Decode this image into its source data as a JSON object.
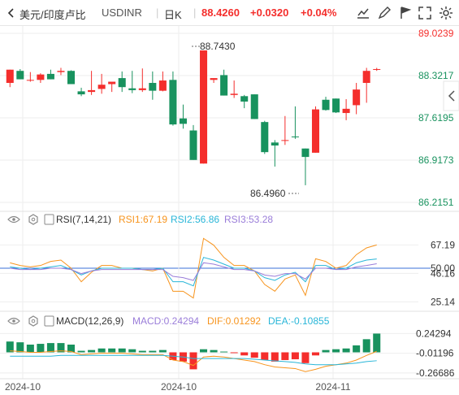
{
  "header": {
    "symbol_label": "美元/印度卢比",
    "symbol_code": "USDINR",
    "period": "日K",
    "price": "88.4260",
    "change": "+0.0320",
    "change_pct": "+0.04%",
    "buttons": [
      "chart-style-icon",
      "draw-icon",
      "flag-icon",
      "fullscreen-icon",
      "settings-icon"
    ]
  },
  "colors": {
    "up": "#f42e2c",
    "down": "#18925e",
    "ma_orange": "#f7941d",
    "ma_blue": "#29b6d8",
    "ma_purple": "#9a7dd9",
    "grid": "#eeeeee",
    "axis_text": "#333333"
  },
  "price_panel": {
    "y_labels": [
      "89.0239",
      "88.3217",
      "87.6195",
      "86.9173",
      "86.2151"
    ],
    "high_label": "88.7430",
    "low_label": "86.4960",
    "collapse_icon": "chevron-left-icon"
  },
  "rsi_panel": {
    "name": "RSI(7,14,21)",
    "rsi1": "RSI1:67.19",
    "rsi2": "RSI2:56.86",
    "rsi3": "RSI3:53.28",
    "y_labels": [
      "67.19",
      "50.00",
      "46.16",
      "25.14"
    ]
  },
  "macd_panel": {
    "name": "MACD(12,26,9)",
    "macd": "MACD:0.24294",
    "dif": "DIF:0.01292",
    "dea": "DEA:-0.10855",
    "y_labels": [
      "0.24294",
      "-0.01196",
      "-0.26686"
    ]
  },
  "x_labels": [
    "2024-10",
    "2024-10",
    "2024-11"
  ],
  "chart_data": [
    {
      "type": "candlestick",
      "ylim": [
        86.2151,
        89.0239
      ],
      "candles": [
        {
          "o": 88.2,
          "h": 88.42,
          "l": 88.13,
          "c": 88.42
        },
        {
          "o": 88.4,
          "h": 88.43,
          "l": 88.26,
          "c": 88.26
        },
        {
          "o": 88.25,
          "h": 88.38,
          "l": 88.22,
          "c": 88.25
        },
        {
          "o": 88.25,
          "h": 88.36,
          "l": 88.2,
          "c": 88.34
        },
        {
          "o": 88.35,
          "h": 88.42,
          "l": 88.26,
          "c": 88.26
        },
        {
          "o": 88.38,
          "h": 88.45,
          "l": 88.33,
          "c": 88.4
        },
        {
          "o": 88.4,
          "h": 88.41,
          "l": 88.18,
          "c": 88.18
        },
        {
          "o": 88.06,
          "h": 88.12,
          "l": 87.98,
          "c": 88.01
        },
        {
          "o": 88.05,
          "h": 88.4,
          "l": 88.0,
          "c": 88.08
        },
        {
          "o": 88.1,
          "h": 88.35,
          "l": 88.02,
          "c": 88.17
        },
        {
          "o": 88.18,
          "h": 88.2,
          "l": 88.05,
          "c": 88.22
        },
        {
          "o": 88.28,
          "h": 88.39,
          "l": 88.05,
          "c": 88.13
        },
        {
          "o": 88.11,
          "h": 88.4,
          "l": 88.03,
          "c": 88.08
        },
        {
          "o": 88.08,
          "h": 88.44,
          "l": 88.05,
          "c": 88.11
        },
        {
          "o": 88.2,
          "h": 88.39,
          "l": 87.92,
          "c": 88.07
        },
        {
          "o": 88.07,
          "h": 88.39,
          "l": 88.06,
          "c": 88.24
        },
        {
          "o": 88.25,
          "h": 88.39,
          "l": 87.49,
          "c": 87.51
        },
        {
          "o": 87.61,
          "h": 87.84,
          "l": 87.44,
          "c": 87.52
        },
        {
          "o": 87.41,
          "h": 87.5,
          "l": 86.92,
          "c": 86.92
        },
        {
          "o": 86.86,
          "h": 88.74,
          "l": 86.86,
          "c": 88.74
        },
        {
          "o": 88.25,
          "h": 88.28,
          "l": 88.2,
          "c": 88.28
        },
        {
          "o": 88.33,
          "h": 88.42,
          "l": 87.99,
          "c": 87.99
        },
        {
          "o": 88.0,
          "h": 88.24,
          "l": 87.95,
          "c": 88.02
        },
        {
          "o": 87.98,
          "h": 88.0,
          "l": 87.78,
          "c": 87.89
        },
        {
          "o": 88.01,
          "h": 88.01,
          "l": 87.6,
          "c": 87.6
        },
        {
          "o": 87.55,
          "h": 87.57,
          "l": 87.02,
          "c": 87.05
        },
        {
          "o": 87.21,
          "h": 87.25,
          "l": 86.81,
          "c": 87.16
        },
        {
          "o": 87.24,
          "h": 87.65,
          "l": 87.17,
          "c": 87.25
        },
        {
          "o": 87.31,
          "h": 87.81,
          "l": 87.27,
          "c": 87.3
        },
        {
          "o": 87.11,
          "h": 87.11,
          "l": 86.5,
          "c": 86.97
        },
        {
          "o": 87.04,
          "h": 87.81,
          "l": 87.04,
          "c": 87.76
        },
        {
          "o": 87.92,
          "h": 87.97,
          "l": 87.74,
          "c": 87.75
        },
        {
          "o": 87.94,
          "h": 87.94,
          "l": 87.7,
          "c": 87.71
        },
        {
          "o": 87.7,
          "h": 87.93,
          "l": 87.58,
          "c": 87.77
        },
        {
          "o": 87.83,
          "h": 88.2,
          "l": 87.68,
          "c": 88.09
        },
        {
          "o": 88.2,
          "h": 88.45,
          "l": 87.87,
          "c": 88.4
        },
        {
          "o": 88.42,
          "h": 88.45,
          "l": 88.4,
          "c": 88.43
        }
      ]
    },
    {
      "type": "line",
      "title": "RSI(7,14,21)",
      "ylim": [
        20,
        80
      ],
      "reference": 50,
      "series": [
        {
          "name": "RSI1",
          "values": [
            54,
            52,
            51,
            52,
            55,
            56,
            50,
            40,
            47,
            52,
            52,
            50,
            50,
            49,
            48,
            50,
            33,
            33,
            28,
            72,
            67,
            58,
            52,
            52,
            48,
            38,
            33,
            42,
            45,
            30,
            57,
            55,
            50,
            52,
            60,
            65,
            67.19
          ]
        },
        {
          "name": "RSI2",
          "values": [
            51,
            50,
            49,
            50,
            51,
            52,
            49,
            45,
            48,
            50,
            50,
            50,
            50,
            49,
            49,
            50,
            40,
            40,
            37,
            58,
            56,
            53,
            50,
            50,
            48,
            43,
            41,
            45,
            47,
            40,
            52,
            52,
            49,
            50,
            54,
            56,
            56.86
          ]
        },
        {
          "name": "RSI3",
          "values": [
            50,
            49,
            49,
            49,
            50,
            50,
            49,
            46,
            48,
            49,
            49,
            49,
            49,
            49,
            49,
            49,
            44,
            43,
            41,
            54,
            53,
            51,
            49,
            49,
            48,
            45,
            44,
            46,
            46,
            42,
            50,
            50,
            49,
            49,
            51,
            52,
            53.28
          ]
        }
      ]
    },
    {
      "type": "bar",
      "title": "MACD(12,26,9)",
      "ylim": [
        -0.3,
        0.3
      ],
      "macd_hist": [
        0.14,
        0.13,
        0.1,
        0.11,
        0.12,
        0.12,
        0.1,
        0.02,
        0.03,
        0.05,
        0.05,
        0.05,
        0.04,
        0.02,
        0.02,
        0.03,
        -0.1,
        -0.12,
        -0.22,
        0.04,
        0.03,
        0.01,
        -0.01,
        -0.04,
        -0.07,
        -0.1,
        -0.12,
        -0.1,
        -0.09,
        -0.14,
        -0.04,
        0.03,
        0.04,
        0.05,
        0.09,
        0.17,
        0.24294
      ],
      "series": [
        {
          "name": "DIF",
          "values": [
            0.02,
            0.01,
            0.0,
            0.0,
            0.01,
            0.02,
            0.01,
            -0.03,
            -0.02,
            -0.01,
            -0.01,
            -0.01,
            -0.02,
            -0.03,
            -0.03,
            -0.03,
            -0.1,
            -0.12,
            -0.17,
            -0.06,
            -0.05,
            -0.06,
            -0.08,
            -0.1,
            -0.12,
            -0.16,
            -0.19,
            -0.2,
            -0.21,
            -0.25,
            -0.22,
            -0.18,
            -0.16,
            -0.14,
            -0.1,
            -0.04,
            0.01292
          ]
        },
        {
          "name": "DEA",
          "values": [
            -0.05,
            -0.05,
            -0.05,
            -0.05,
            -0.05,
            -0.04,
            -0.04,
            -0.04,
            -0.04,
            -0.04,
            -0.04,
            -0.04,
            -0.04,
            -0.04,
            -0.04,
            -0.04,
            -0.05,
            -0.06,
            -0.08,
            -0.08,
            -0.08,
            -0.08,
            -0.08,
            -0.08,
            -0.09,
            -0.1,
            -0.11,
            -0.12,
            -0.13,
            -0.15,
            -0.16,
            -0.16,
            -0.16,
            -0.15,
            -0.14,
            -0.12,
            -0.10855
          ]
        }
      ]
    }
  ]
}
